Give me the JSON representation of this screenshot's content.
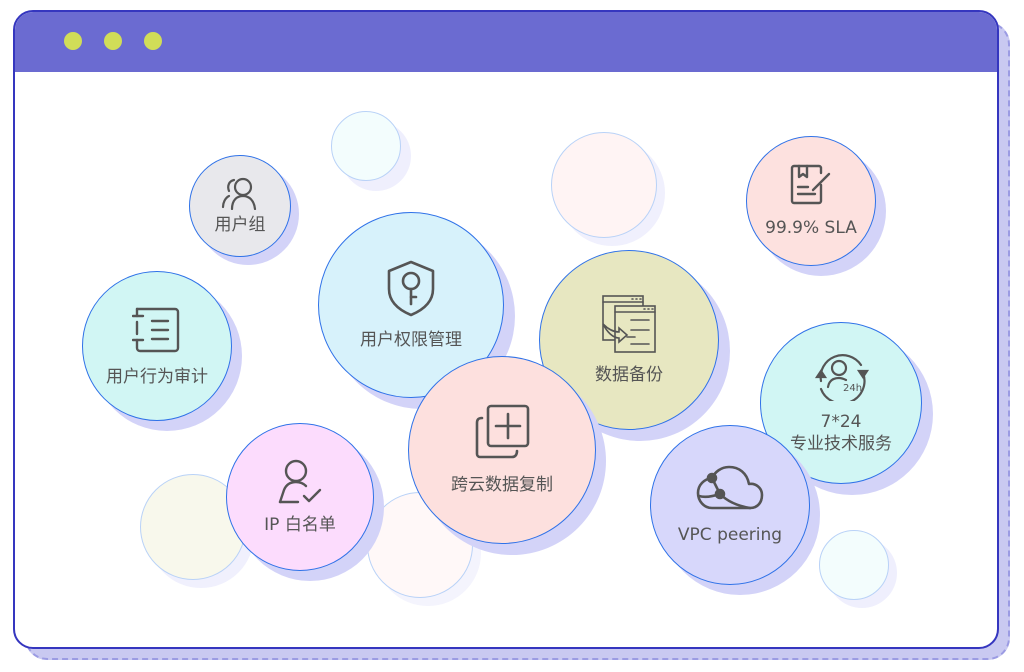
{
  "window": {
    "controls": [
      "dot-1",
      "dot-2",
      "dot-3"
    ],
    "colors": {
      "titlebar": "#6b6bd1",
      "border": "#3536bf",
      "dots": "#d1dd58"
    }
  },
  "features": [
    {
      "id": "user-group",
      "label": "用户组",
      "icon": "users-icon",
      "color": "#e8e8ec"
    },
    {
      "id": "user-permission",
      "label": "用户权限管理",
      "icon": "shield-key-icon",
      "color": "#d7f2fb"
    },
    {
      "id": "data-backup",
      "label": "数据备份",
      "icon": "backup-windows-icon",
      "color": "#e7e7c1"
    },
    {
      "id": "sla",
      "label": "99.9% SLA",
      "icon": "document-edit-icon",
      "color": "#fde1df"
    },
    {
      "id": "support",
      "label_line1": "7*24",
      "label_line2": "专业技术服务",
      "icon": "support-24h-icon",
      "color": "#d1f6f4"
    },
    {
      "id": "vpc-peering",
      "label": "VPC peering",
      "icon": "cloud-network-icon",
      "color": "#d7d7fb"
    },
    {
      "id": "cross-cloud-replication",
      "label": "跨云数据复制",
      "icon": "copy-add-icon",
      "color": "#fde0de"
    },
    {
      "id": "user-audit",
      "label": "用户行为审计",
      "icon": "list-audit-icon",
      "color": "#d1f6f4"
    },
    {
      "id": "ip-whitelist",
      "label": "IP 白名单",
      "icon": "user-check-icon",
      "color": "#fcdcfd"
    }
  ]
}
